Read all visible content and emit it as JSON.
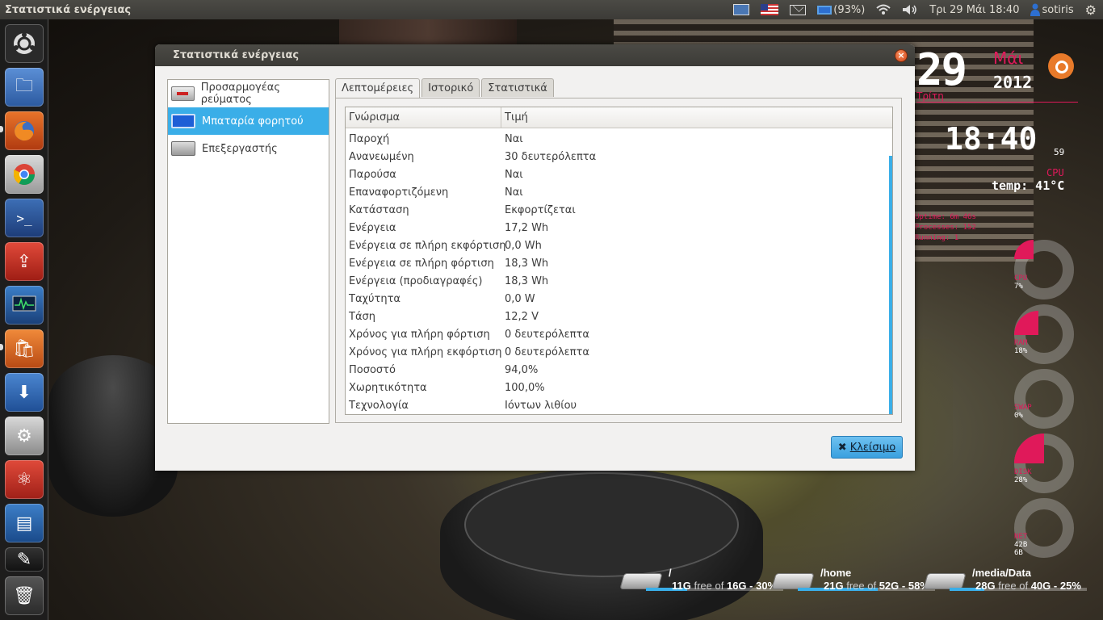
{
  "top_panel": {
    "window_title": "Στατιστικά ενέργειας",
    "battery_percent": "(93%)",
    "clock": "Τρι 29 Μάι 18:40",
    "user": "sotiris"
  },
  "dialog": {
    "title": "Στατιστικά ενέργειας",
    "devices": [
      {
        "label": "Προσαρμογέας ρεύματος",
        "icon": "power-adapter-icon"
      },
      {
        "label": "Μπαταρία φορητού",
        "icon": "laptop-battery-icon"
      },
      {
        "label": "Επεξεργαστής",
        "icon": "processor-icon"
      }
    ],
    "tabs": [
      "Λεπτομέρειες",
      "Ιστορικό",
      "Στατιστικά"
    ],
    "columns": [
      "Γνώρισμα",
      "Τιμή"
    ],
    "rows": [
      [
        "Παροχή",
        "Ναι"
      ],
      [
        "Ανανεωμένη",
        "30 δευτερόλεπτα"
      ],
      [
        "Παρούσα",
        "Ναι"
      ],
      [
        "Επαναφορτιζόμενη",
        "Ναι"
      ],
      [
        "Κατάσταση",
        "Εκφορτίζεται"
      ],
      [
        "Ενέργεια",
        "17,2 Wh"
      ],
      [
        "Ενέργεια σε πλήρη εκφόρτιση",
        "0,0 Wh"
      ],
      [
        "Ενέργεια σε πλήρη φόρτιση",
        "18,3 Wh"
      ],
      [
        "Ενέργεια (προδιαγραφές)",
        "18,3 Wh"
      ],
      [
        "Ταχύτητα",
        "0,0 W"
      ],
      [
        "Τάση",
        "12,2 V"
      ],
      [
        "Χρόνος για πλήρη φόρτιση",
        "0 δευτερόλεπτα"
      ],
      [
        "Χρόνος για πλήρη εκφόρτιση",
        "0 δευτερόλεπτα"
      ],
      [
        "Ποσοστό",
        "94,0%"
      ],
      [
        "Χωρητικότητα",
        "100,0%"
      ],
      [
        "Τεχνολογία",
        "Ιόντων λιθίου"
      ]
    ],
    "close_label": "Κλείσιμο"
  },
  "conky": {
    "day": "29",
    "month": "Μάι",
    "year": "2012",
    "weekday": "Τρίτη",
    "time": "18:40",
    "seconds": "59",
    "cpu_label": "CPU",
    "temp": "temp: 41°C",
    "uptime": "Uptime: 6m 46s",
    "processes": "Processes: 152",
    "running": "Running: 1",
    "gauges": [
      {
        "name": "CPU",
        "value": "7%"
      },
      {
        "name": "RAM",
        "value": "18%"
      },
      {
        "name": "SWAP",
        "value": "0%"
      },
      {
        "name": "DISK",
        "value": "28%"
      },
      {
        "name": "NET",
        "value": "42B"
      }
    ],
    "net_extra": "6B"
  },
  "drives": [
    {
      "mount": "/",
      "free": "11G",
      "size": "16G",
      "pct": "30%",
      "used_fraction": 0.3
    },
    {
      "mount": "/home",
      "free": "21G",
      "size": "52G",
      "pct": "58%",
      "used_fraction": 0.58
    },
    {
      "mount": "/media/Data",
      "free": "28G",
      "size": "40G",
      "pct": "25%",
      "used_fraction": 0.25
    }
  ],
  "drive_text": {
    "free_of": "free of",
    "dash": "-"
  },
  "colors": {
    "accent": "#3aaee8",
    "conky_red": "#e0195a",
    "panel": "#3c3b37"
  }
}
